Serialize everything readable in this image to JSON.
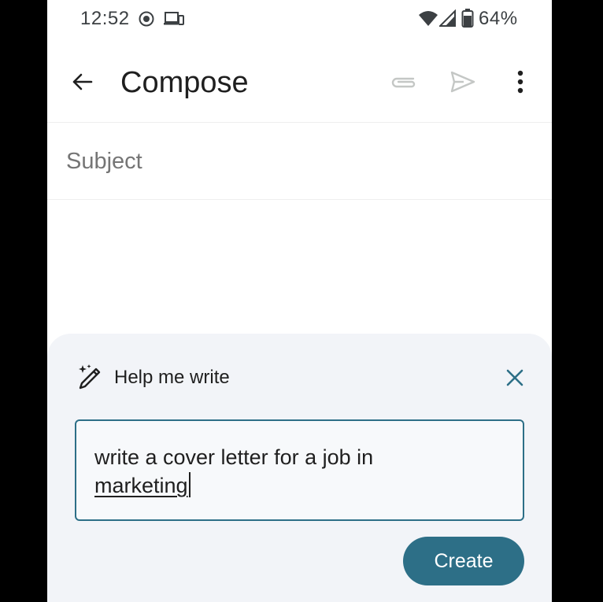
{
  "status_bar": {
    "time": "12:52",
    "battery_percent": "64%",
    "icons": [
      "record-icon",
      "cast-device-icon",
      "wifi-icon",
      "cellular-signal-icon",
      "battery-icon"
    ]
  },
  "app_bar": {
    "title": "Compose",
    "icons": [
      "back-arrow-icon",
      "attach-icon",
      "send-icon",
      "more-vert-icon"
    ]
  },
  "subject": {
    "placeholder": "Subject",
    "value": ""
  },
  "help_me_write": {
    "title": "Help me write",
    "icons": [
      "magic-pen-icon",
      "close-icon"
    ],
    "prompt_line_1": "write a cover letter for a job in",
    "prompt_line_2": "marketing",
    "create_label": "Create"
  },
  "colors": {
    "accent": "#2d6f87",
    "sheet_background": "#f2f4f8",
    "text_primary": "#1f1f1f",
    "icon_disabled": "#c4c7c5"
  }
}
